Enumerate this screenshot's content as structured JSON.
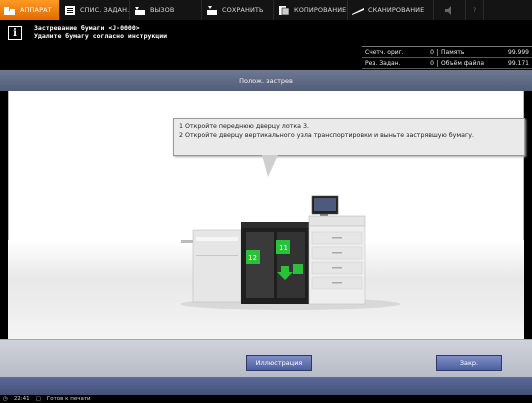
{
  "tabs": [
    {
      "label": "АППАРАТ",
      "icon": "machine-icon",
      "active": true
    },
    {
      "label": "СПИС. ЗАДАН.",
      "icon": "job-list-icon"
    },
    {
      "label": "ВЫЗОВ",
      "icon": "recall-icon"
    },
    {
      "label": "СОХРАНИТЬ",
      "icon": "save-icon"
    },
    {
      "label": "КОПИРОВАНИЕ",
      "icon": "copy-icon"
    },
    {
      "label": "СКАНИРОВАНИЕ",
      "icon": "scan-icon"
    },
    {
      "label": "",
      "icon": "volume-icon"
    },
    {
      "label": "?",
      "icon": "help-icon"
    }
  ],
  "message": {
    "icon": "info-icon",
    "line1": "Застревание бумаги <J-0000>",
    "line2": "Удалите бумагу согласно инструкции"
  },
  "stats": {
    "r1c1": "Счетч. ориг.",
    "r1c2": "0",
    "r1c3": "Память",
    "r1c4": "99.999",
    "r2c1": "Рез. Задан.",
    "r2c2": "0",
    "r2c3": "Объём файла",
    "r2c4": "99.171"
  },
  "title": "Полож. застрев",
  "instruction": {
    "line1": "1 Откройте переднюю дверцу лотка 3.",
    "line2": "2 Откройте дверцу вертикального узла транспортировки и выньте застрявшую бумагу."
  },
  "illustration": {
    "label_a": "11",
    "label_b": "12"
  },
  "buttons": {
    "illustration": "Иллюстрация",
    "close": "Закр."
  },
  "status": {
    "time": "22:41",
    "text": "Готов к печати"
  },
  "colors": {
    "accent": "#f08a10",
    "title_bar": "#5d6985",
    "button": "#5c6eac",
    "green_marker": "#2bbf3a"
  }
}
